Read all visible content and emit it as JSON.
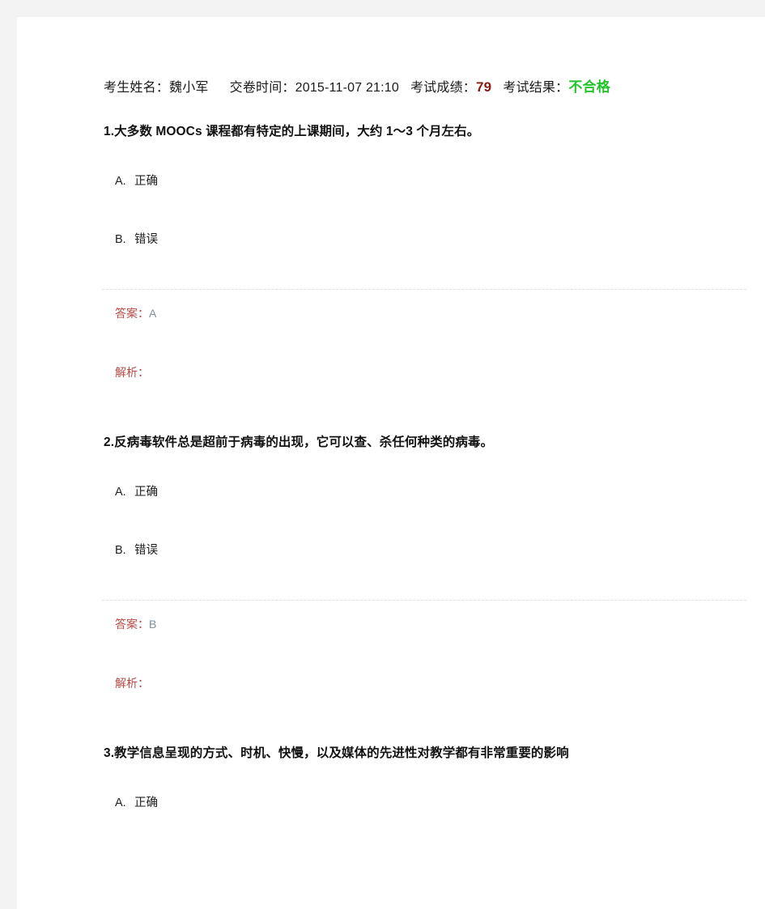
{
  "header": {
    "name_label": "考生姓名：",
    "name_value": "魏小军",
    "submit_label": "交卷时间：",
    "submit_value": "2015-11-07 21:10",
    "score_label": "考试成绩：",
    "score_value": "79",
    "result_label": "考试结果：",
    "result_value": "不合格"
  },
  "labels": {
    "answer_label": "答案：",
    "analysis_label": "解析："
  },
  "questions": [
    {
      "title": "1.大多数 MOOCs 课程都有特定的上课期间，大约 1～3 个月左右。",
      "options": [
        {
          "key": "A.",
          "text": "正确"
        },
        {
          "key": "B.",
          "text": "错误"
        }
      ],
      "answer": "A",
      "analysis": ""
    },
    {
      "title": "2.反病毒软件总是超前于病毒的出现，它可以查、杀任何种类的病毒。",
      "options": [
        {
          "key": "A.",
          "text": "正确"
        },
        {
          "key": "B.",
          "text": "错误"
        }
      ],
      "answer": "B",
      "analysis": ""
    },
    {
      "title": "3.教学信息呈现的方式、时机、快慢，以及媒体的先进性对教学都有非常重要的影响",
      "options": [
        {
          "key": "A.",
          "text": "正确"
        }
      ],
      "answer": "",
      "analysis": ""
    }
  ]
}
